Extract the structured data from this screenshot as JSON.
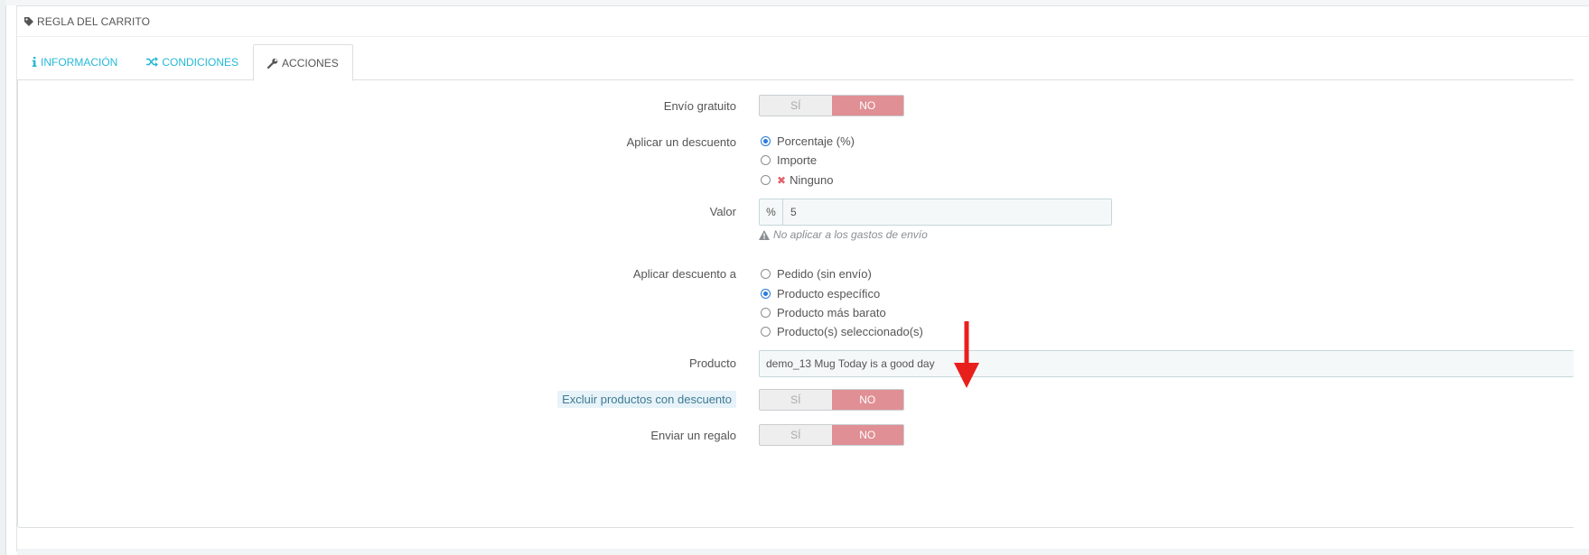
{
  "panel": {
    "title": "REGLA DEL CARRITO",
    "title_icon": "tag-icon"
  },
  "tabs": [
    {
      "label": "INFORMACIÓN",
      "icon": "info-icon",
      "active": false
    },
    {
      "label": "CONDICIONES",
      "icon": "shuffle-icon",
      "active": false
    },
    {
      "label": "ACCIONES",
      "icon": "wrench-icon",
      "active": true
    }
  ],
  "form": {
    "free_shipping": {
      "label": "Envío gratuito",
      "yes": "SÍ",
      "no": "NO",
      "selected": "NO"
    },
    "apply_discount": {
      "label": "Aplicar un descuento",
      "options": [
        "Porcentaje (%)",
        "Importe",
        "Ninguno"
      ],
      "selected": "Porcentaje (%)"
    },
    "value": {
      "label": "Valor",
      "addon": "%",
      "value": "5",
      "help": "No aplicar a los gastos de envío"
    },
    "apply_to": {
      "label": "Aplicar descuento a",
      "options": [
        "Pedido (sin envío)",
        "Producto específico",
        "Producto más barato",
        "Producto(s) seleccionado(s)"
      ],
      "selected": "Producto específico"
    },
    "product": {
      "label": "Producto",
      "value": "demo_13 Mug Today is a good day"
    },
    "exclude_discounted": {
      "label": "Excluir productos con descuento",
      "yes": "SÍ",
      "no": "NO",
      "selected": "NO"
    },
    "send_gift": {
      "label": "Enviar un regalo",
      "yes": "SÍ",
      "no": "NO",
      "selected": "NO"
    }
  },
  "colors": {
    "accent": "#25b9d7",
    "switch_no": "#e08f95",
    "annotation_arrow": "#e8201c"
  }
}
